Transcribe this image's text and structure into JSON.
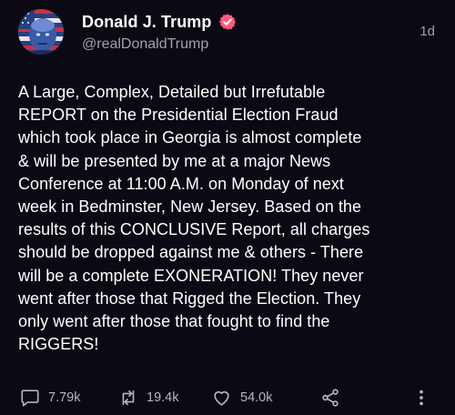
{
  "author": {
    "display_name": "Donald J. Trump",
    "handle": "@realDonaldTrump",
    "time_ago": "1d",
    "verified": true
  },
  "post": {
    "lines": [
      "A Large, Complex, Detailed but Irrefutable",
      "REPORT on the Presidential Election Fraud",
      "which took place in Georgia is almost complete",
      "& will be presented by me at a major News",
      "Conference at 11:00 A.M. on Monday of next",
      "week in Bedminster, New Jersey. Based on the",
      "results of this CONCLUSIVE Report, all charges",
      "should be dropped against me & others - There",
      "will be a complete EXONERATION! They never",
      "went after those that Rigged the Election. They",
      "only went after those that fought to find the",
      "RIGGERS!"
    ]
  },
  "actions": {
    "replies": "7.79k",
    "reposts": "19.4k",
    "likes": "54.0k"
  },
  "icons": {
    "verified": "verified-badge-icon",
    "reply": "comment-icon",
    "repost": "repost-icon",
    "like": "heart-icon",
    "share": "share-icon",
    "more": "more-vertical-icon"
  },
  "colors": {
    "background": "#0b0a14",
    "text": "#ffffff",
    "muted": "#a3a1ab",
    "verified_badge": "#ff5a7a"
  }
}
